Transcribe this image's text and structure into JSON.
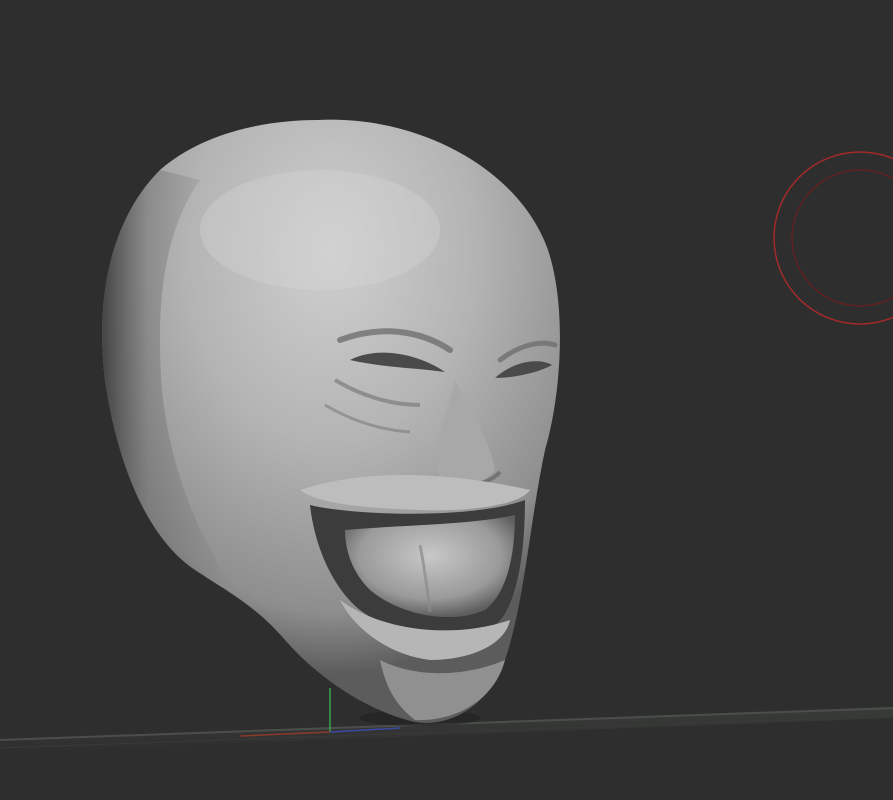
{
  "viewport": {
    "background_color": "#2e2e2e",
    "floor_grid_color": "#4a4f4a",
    "axis_x_color": "#8a3a2a",
    "axis_y_color": "#3aa24a",
    "axis_z_color": "#3a4aa2",
    "brush_cursor_color": "#a32a2a"
  },
  "model": {
    "type": "sculpt-head",
    "material_color": "#b4b4b4"
  }
}
